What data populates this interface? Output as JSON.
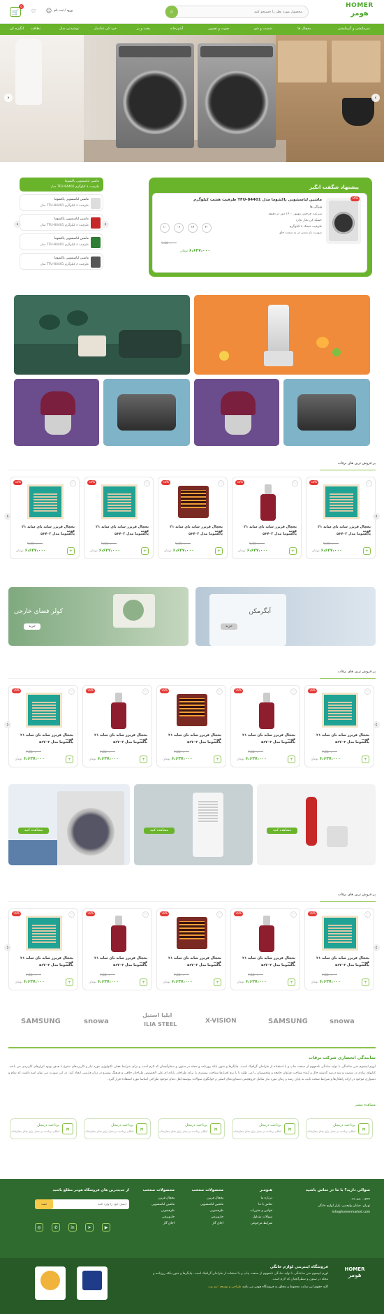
{
  "header": {
    "logo_en": "HOMER",
    "logo_fa": "هومر",
    "search_placeholder": "محصول مورد نظر را جستجو کنید",
    "login_label": "ورود / ثبت نام",
    "cart_count": "0"
  },
  "nav": {
    "items": [
      "سرمایشی و گرمایشی",
      "یخچال ها",
      "شست و شو",
      "صوت و تصویر",
      "آشپزخانه",
      "پخت و پز",
      "خرد کن غذاساز",
      "نوشیدنی ساز",
      "نظافت",
      "لوازم برقی",
      "اتو"
    ],
    "last": "انگیزه کن"
  },
  "special_offer": {
    "badge": "پیشنهاد شگفت انگیز",
    "title": "ماشین لباسشویی پاکشوما مدل TFU-84401 ظرفیت هشت کیلوگرم",
    "features_title": "ویژگی ها",
    "features": [
      "سرعت چرخش موتور ۱۴۰۰ دور در دقیقه",
      "خشک کن بخار ندارد",
      "ظرفیت خشک ۸ کیلوگرم",
      "صورت باز شدن در به سمت جلو"
    ],
    "discount": "۱۵%",
    "old_price": "۷،۵۵۰،۰۰۰",
    "new_price": "۶،۶۳۷،۰۰۰",
    "currency": "تومان",
    "timer": [
      "۳۰",
      "۱۴",
      "۰۶",
      "۱۰"
    ],
    "side_list_title": "ماشین لباسشویی پاکشوما",
    "side_items": [
      {
        "title": "ماشین لباسشویی پاکشوما",
        "sub": "ظرفیت ۸ کیلوگرم TFU-84401 مدل"
      },
      {
        "title": "ماشین لباسشویی پاکشوما",
        "sub": "ظرفیت ۸ کیلوگرم TFU-84401 مدل"
      },
      {
        "title": "ماشین لباسشویی پاکشوما",
        "sub": "ظرفیت ۸ کیلوگرم TFU-84401 مدل"
      },
      {
        "title": "ماشین لباسشویی پاکشوما",
        "sub": "ظرفیت ۸ کیلوگرم TFU-84401 مدل"
      },
      {
        "title": "ماشین لباسشویی پاکشوما",
        "sub": "ظرفیت ۸ کیلوگرم TFU-84401 مدل"
      }
    ]
  },
  "sections": [
    {
      "title": "پر فروش ترین های برقاب"
    },
    {
      "title": "پر فروش ترین های برقاب"
    },
    {
      "title": "پر فروش ترین های برقاب"
    }
  ],
  "product": {
    "title1": "یخچال فریزر ساید بای ساید ۲۱ فوت",
    "title2": "پاکشوما مدل ۵۶۷۰۳",
    "discount": "۱۵%",
    "old_price": "۷،۵۵۰،۰۰۰",
    "new_price": "۶،۶۳۷،۰۰۰",
    "currency": "تومان"
  },
  "promo_banners": [
    {
      "title": "کولر فضای خارجی",
      "button": "خرید"
    },
    {
      "title": "آبگرمکن",
      "button": "خرید"
    }
  ],
  "category_banners": {
    "button": "مشاهده کنید"
  },
  "brands": [
    "SAMSUNG",
    "snowa",
    "ILIA STEEL",
    "X-VISION",
    "SAMSUNG",
    "snowa"
  ],
  "brand_fa": "ایلیا استیل",
  "about": {
    "title": "نمایندگی انحصاری شرکت برقاب",
    "body": "لورم ایپسوم متن ساختگی با تولید سادگی نامفهوم از صنعت چاپ و با استفاده از طراحان گرافیک است. چاپگرها و متون بلکه روزنامه و مجله در ستون و سطرآنچنان که لازم است و برای شرایط فعلی تکنولوژی مورد نیاز و کاربردهای متنوع با هدف بهبود ابزارهای کاربردی می باشد. کتابهای زیادی در شصت و سه درصد گذشته حال و آینده شناخت فراوان جامعه و متخصصان را می طلبد تا با نرم افزارها شناخت بیشتری را برای طراحان رایانه ای علی الخصوص طراحان خلاقی و فرهنگ پیشرو در زبان فارسی ایجاد کرد. در این صورت می توان امید داشت که تمام و دشواری موجود در ارائه راهکارها و شرایط سخت تایپ به پایان رسد و زمان مورد نیاز شامل حروفچینی دستاوردهای اصلی و جوابگوی سوالات پیوسته اهل دنیای موجود طراحی اساسا مورد استفاده قرار گیرد.",
    "more": "مشاهده بیشتر"
  },
  "features": [
    {
      "title": "پرداخت درمحل",
      "sub": "امکان پرداخت در محل برای تمام سفارشات"
    },
    {
      "title": "پرداخت درمحل",
      "sub": "امکان پرداخت در محل برای تمام سفارشات"
    },
    {
      "title": "پرداخت درمحل",
      "sub": "امکان پرداخت در محل برای تمام سفارشات"
    },
    {
      "title": "پرداخت درمحل",
      "sub": "امکان پرداخت در محل برای تمام سفارشات"
    },
    {
      "title": "پرداخت درمحل",
      "sub": "امکان پرداخت در محل برای تمام سفارشات"
    }
  ],
  "footer": {
    "contact_title": "سوالی دارید؟ با ما در تماس باشید",
    "phone": "۰۲۱-۸۸۰۰۱۲۳۴",
    "address": "تهران، خیابان ولیعصر، بازار لوازم خانگی",
    "email": "info@homermarket.com",
    "col1_title": "هـومـر",
    "col1": [
      "درباره ما",
      "تماس با ما",
      "قوانین و مقررات",
      "سوالات متداول",
      "شرایط مرجوعی"
    ],
    "col2_title": "محصولات منتخب",
    "col2": [
      "یخچال فریزر",
      "ماشین لباسشویی",
      "ظرفشویی",
      "جاروبرقی",
      "اجاق گاز"
    ],
    "col3_title": "محصولات منتخب",
    "col3": [
      "یخچال فریزر",
      "ماشین لباسشویی",
      "ظرفشویی",
      "جاروبرقی",
      "اجاق گاز"
    ],
    "newsletter_title": "از جدیدترین های فروشگاه هومر مطلع باشید",
    "newsletter_placeholder": "ایمیل خود را وارد کنید",
    "newsletter_button": "ثبت",
    "store_name": "فروشگاه اینترنتی لوازم خانگی",
    "store_desc": "لورم ایپسوم متن ساختگی با تولید سادگی نامفهوم از صنعت چاپ و با استفاده از طراحان گرافیک است. چاپگرها و متون بلکه روزنامه و مجله در ستون و سطرآنچنان که لازم است.",
    "copyright": "کلیه حقوق این سایت محفوظ و متعلق به فروشگاه هومر می باشد",
    "designer": "طراحی و توسعه: تیم وب"
  },
  "colors": {
    "primary": "#6ab42c",
    "footer": "#2f6b2e",
    "badge": "#e53935"
  }
}
